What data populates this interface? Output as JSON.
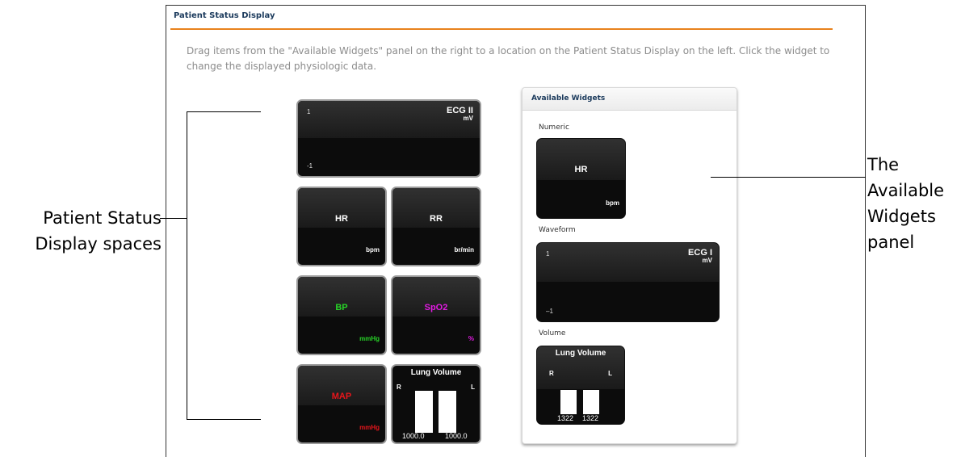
{
  "frame": {
    "title": "Patient Status Display",
    "instructions": "Drag items from the \"Available Widgets\" panel on the right to a location on the Patient Status Display on the left. Click the widget to change the displayed physiologic data."
  },
  "display": {
    "ecg": {
      "title": "ECG II",
      "unit": "mV",
      "scale_top": "1",
      "scale_bottom": "-1"
    },
    "hr": {
      "label": "HR",
      "unit": "bpm",
      "color": "#ffffff"
    },
    "rr": {
      "label": "RR",
      "unit": "br/min",
      "color": "#ffffff"
    },
    "bp": {
      "label": "BP",
      "unit": "mmHg",
      "color": "#27d327"
    },
    "spo2": {
      "label": "SpO2",
      "unit": "%",
      "color": "#e21be2"
    },
    "map": {
      "label": "MAP",
      "unit": "mmHg",
      "color": "#e8151b"
    },
    "lung": {
      "title": "Lung Volume",
      "right": "R",
      "left": "L",
      "value_r": "1000.0",
      "value_l": "1000.0"
    }
  },
  "panel": {
    "title": "Available Widgets",
    "numeric_label": "Numeric",
    "numeric": {
      "label": "HR",
      "unit": "bpm"
    },
    "waveform_label": "Waveform",
    "waveform": {
      "title": "ECG I",
      "unit": "mV",
      "scale_top": "1",
      "scale_bottom": "–1"
    },
    "volume_label": "Volume",
    "volume": {
      "title": "Lung Volume",
      "right": "R",
      "left": "L",
      "value_r": "1322",
      "value_l": "1322"
    }
  },
  "annotations": {
    "left_line1": "Patient Status",
    "left_line2": "Display spaces",
    "right_line1": "The",
    "right_line2": "Available",
    "right_line3": "Widgets",
    "right_line4": "panel"
  }
}
